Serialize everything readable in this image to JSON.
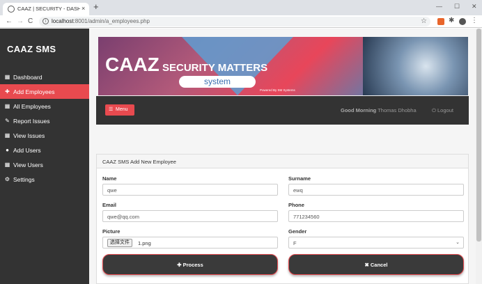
{
  "browser": {
    "tab_title": "CAAZ | SECURITY - DASHBOARD",
    "tab_close": "×",
    "new_tab": "+",
    "url_host": "localhost",
    "url_rest": ":8001/admin/a_employees.php",
    "minimize": "—",
    "maximize": "☐",
    "close": "✕",
    "back": "←",
    "forward": "→",
    "reload": "C",
    "star": "☆",
    "puzzle": "✱",
    "menu": "⋮"
  },
  "sidebar": {
    "brand": "CAAZ SMS",
    "items": [
      {
        "label": "Dashboard",
        "icon": "▦"
      },
      {
        "label": "Add Employees",
        "icon": "✚"
      },
      {
        "label": "All Employees",
        "icon": "▦"
      },
      {
        "label": "Report Issues",
        "icon": "✎"
      },
      {
        "label": "View Issues",
        "icon": "▦"
      },
      {
        "label": "Add Users",
        "icon": "●"
      },
      {
        "label": "View Users",
        "icon": "▦"
      },
      {
        "label": "Settings",
        "icon": "⚙"
      }
    ],
    "active_color": "#e84a4f"
  },
  "banner": {
    "caaz": "CAAZ",
    "security_matters": "SECURITY MATTERS",
    "system": "system",
    "powered": "Powered By SM Systems"
  },
  "topbar": {
    "menu_icon": "☰",
    "menu_label": "Menu",
    "greeting": "Good Morning",
    "user": "Thomas Dhobha",
    "logout": "⏻ Logout"
  },
  "form": {
    "title": "CAAZ SMS Add New Employee",
    "name_label": "Name",
    "name_value": "qwe",
    "surname_label": "Surname",
    "surname_value": "ewq",
    "email_label": "Email",
    "email_value": "qwe@qq.com",
    "phone_label": "Phone",
    "phone_value": "771234560",
    "picture_label": "Picture",
    "file_button": "选择文件",
    "file_name": "1.png",
    "gender_label": "Gender",
    "gender_value": "F",
    "chevron": "⌄",
    "process_label": "✚ Process",
    "cancel_label": "✖ Cancel"
  }
}
